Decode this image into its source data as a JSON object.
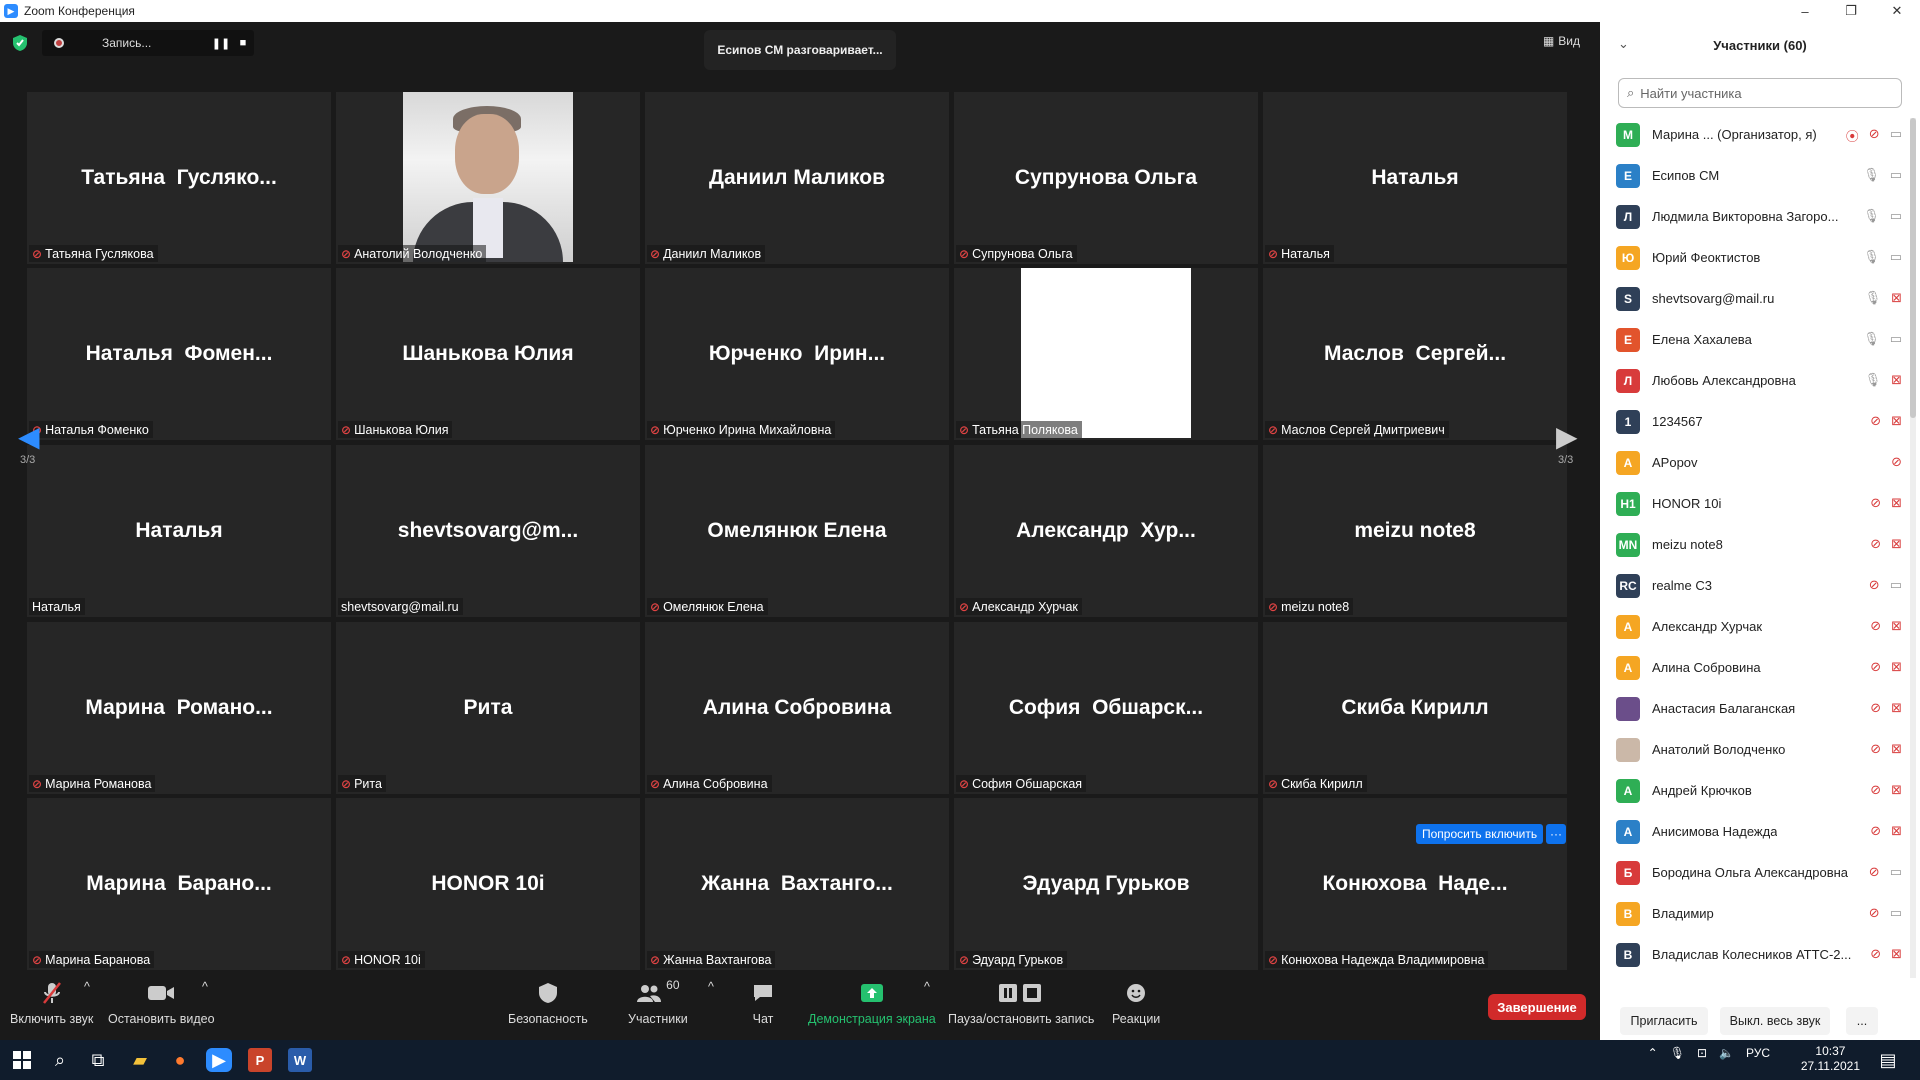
{
  "window": {
    "title": "Zoom Конференция",
    "minimize": "–",
    "restore": "❐",
    "close": "✕"
  },
  "top": {
    "recording_label": "Запись...",
    "pause_glyph": "❚❚",
    "stop_glyph": "■",
    "talking": "Есипов СМ разговаривает...",
    "view_label": "Вид"
  },
  "tiles": [
    {
      "big": "Татьяна  Гусляко...",
      "label": "Татьяна Гуслякова",
      "muted": true,
      "media": "none"
    },
    {
      "big": "",
      "label": "Анатолий Володченко",
      "muted": true,
      "media": "photo"
    },
    {
      "big": "Даниил Маликов",
      "label": "Даниил Маликов",
      "muted": true,
      "media": "none"
    },
    {
      "big": "Супрунова Ольга",
      "label": "Супрунова Ольга",
      "muted": true,
      "media": "none"
    },
    {
      "big": "Наталья",
      "label": "Наталья",
      "muted": true,
      "media": "none"
    },
    {
      "big": "Наталья  Фомен...",
      "label": "Наталья Фоменко",
      "muted": true,
      "media": "none"
    },
    {
      "big": "Шанькова Юлия",
      "label": "Шанькова Юлия",
      "muted": true,
      "media": "none"
    },
    {
      "big": "Юрченко  Ирин...",
      "label": "Юрченко Ирина Михайловна",
      "muted": true,
      "media": "none"
    },
    {
      "big": "",
      "label": "Татьяна Полякова",
      "muted": true,
      "media": "white"
    },
    {
      "big": "Маслов  Сергей...",
      "label": "Маслов Сергей Дмитриевич",
      "muted": true,
      "media": "none"
    },
    {
      "big": "Наталья",
      "label": "Наталья",
      "muted": false,
      "media": "none"
    },
    {
      "big": "shevtsovarg@m...",
      "label": "shevtsovarg@mail.ru",
      "muted": false,
      "media": "none"
    },
    {
      "big": "Омелянюк Елена",
      "label": "Омелянюк Елена",
      "muted": true,
      "media": "none"
    },
    {
      "big": "Александр  Хур...",
      "label": "Александр Хурчак",
      "muted": true,
      "media": "none"
    },
    {
      "big": "meizu note8",
      "label": "meizu note8",
      "muted": true,
      "media": "none"
    },
    {
      "big": "Марина  Романо...",
      "label": "Марина Романова",
      "muted": true,
      "media": "none"
    },
    {
      "big": "Рита",
      "label": "Рита",
      "muted": true,
      "media": "none"
    },
    {
      "big": "Алина Собровина",
      "label": "Алина Собровина",
      "muted": true,
      "media": "none"
    },
    {
      "big": "София  Обшарск...",
      "label": "София Обшарская",
      "muted": true,
      "media": "none"
    },
    {
      "big": "Скиба Кирилл",
      "label": "Скиба Кирилл",
      "muted": true,
      "media": "none"
    },
    {
      "big": "Марина  Барано...",
      "label": "Марина Баранова",
      "muted": true,
      "media": "none"
    },
    {
      "big": "HONOR 10i",
      "label": "HONOR 10i",
      "muted": true,
      "media": "none"
    },
    {
      "big": "Жанна  Вахтанго...",
      "label": "Жанна Вахтангова",
      "muted": true,
      "media": "none"
    },
    {
      "big": "Эдуард Гурьков",
      "label": "Эдуард Гурьков",
      "muted": true,
      "media": "none"
    },
    {
      "big": "Конюхова  Наде...",
      "label": "Конюхова Надежда Владимировна",
      "muted": true,
      "media": "none"
    }
  ],
  "gallery": {
    "page_left": "3/3",
    "page_right": "3/3",
    "ask_unmute": "Попросить включить",
    "more": "···"
  },
  "toolbar": {
    "unmute": "Включить звук",
    "stop_video": "Остановить видео",
    "security": "Безопасность",
    "participants": "Участники",
    "participants_count": "60",
    "chat": "Чат",
    "share": "Демонстрация экрана",
    "pause_record": "Пауза/остановить запись",
    "reactions": "Реакции",
    "end": "Завершение"
  },
  "panel": {
    "title": "Участники (60)",
    "search_placeholder": "Найти участника",
    "invite": "Пригласить",
    "mute_all": "Выкл. весь звук",
    "more": "..."
  },
  "participants": [
    {
      "initials": "М",
      "color": "#2fae55",
      "name": "Марина ...   (Организатор, я)",
      "mic": "off",
      "cam": "on",
      "rec": true
    },
    {
      "initials": "Е",
      "color": "#2b80c7",
      "name": "Есипов СМ",
      "mic": "on",
      "cam": "on"
    },
    {
      "initials": "Л",
      "color": "#2f4058",
      "name": "Людмила Викторовна Загоро...",
      "mic": "on",
      "cam": "on"
    },
    {
      "initials": "Ю",
      "color": "#f5a623",
      "name": "Юрий Феоктистов",
      "mic": "on",
      "cam": "on"
    },
    {
      "initials": "S",
      "color": "#2f4058",
      "name": "shevtsovarg@mail.ru",
      "mic": "on",
      "cam": "off"
    },
    {
      "initials": "Е",
      "color": "#e2542c",
      "name": "Елена Хахалева",
      "mic": "on",
      "cam": "on"
    },
    {
      "initials": "Л",
      "color": "#d83b3b",
      "name": "Любовь Александровна",
      "mic": "on",
      "cam": "off"
    },
    {
      "initials": "1",
      "color": "#2f4058",
      "name": "1234567",
      "mic": "off",
      "cam": "off"
    },
    {
      "initials": "А",
      "color": "#f5a623",
      "name": "APopov",
      "mic": "off",
      "cam": "none"
    },
    {
      "initials": "H1",
      "color": "#2fae55",
      "name": "HONOR 10i",
      "mic": "off",
      "cam": "off"
    },
    {
      "initials": "MN",
      "color": "#2fae55",
      "name": "meizu note8",
      "mic": "off",
      "cam": "off"
    },
    {
      "initials": "RC",
      "color": "#2f4058",
      "name": "realme C3",
      "mic": "off",
      "cam": "on"
    },
    {
      "initials": "А",
      "color": "#f5a623",
      "name": "Александр Хурчак",
      "mic": "off",
      "cam": "off"
    },
    {
      "initials": "А",
      "color": "#f5a623",
      "name": "Алина Собровина",
      "mic": "off",
      "cam": "off"
    },
    {
      "initials": "",
      "color": "#6b4e8a",
      "name": "Анастасия Балаганская",
      "mic": "off",
      "cam": "off",
      "photo": true
    },
    {
      "initials": "",
      "color": "#cbb8a8",
      "name": "Анатолий Володченко",
      "mic": "off",
      "cam": "off",
      "photo": true
    },
    {
      "initials": "А",
      "color": "#2fae55",
      "name": "Андрей Крючков",
      "mic": "off",
      "cam": "off"
    },
    {
      "initials": "А",
      "color": "#2b80c7",
      "name": "Анисимова Надежда",
      "mic": "off",
      "cam": "off"
    },
    {
      "initials": "Б",
      "color": "#d83b3b",
      "name": "Бородина Ольга Александровна",
      "mic": "off",
      "cam": "on"
    },
    {
      "initials": "В",
      "color": "#f5a623",
      "name": "Владимир",
      "mic": "off",
      "cam": "on"
    },
    {
      "initials": "В",
      "color": "#2f4058",
      "name": "Владислав Колесников АТТС-2...",
      "mic": "off",
      "cam": "off"
    }
  ],
  "taskbar": {
    "lang": "РУС",
    "time": "10:37",
    "date": "27.11.2021"
  }
}
